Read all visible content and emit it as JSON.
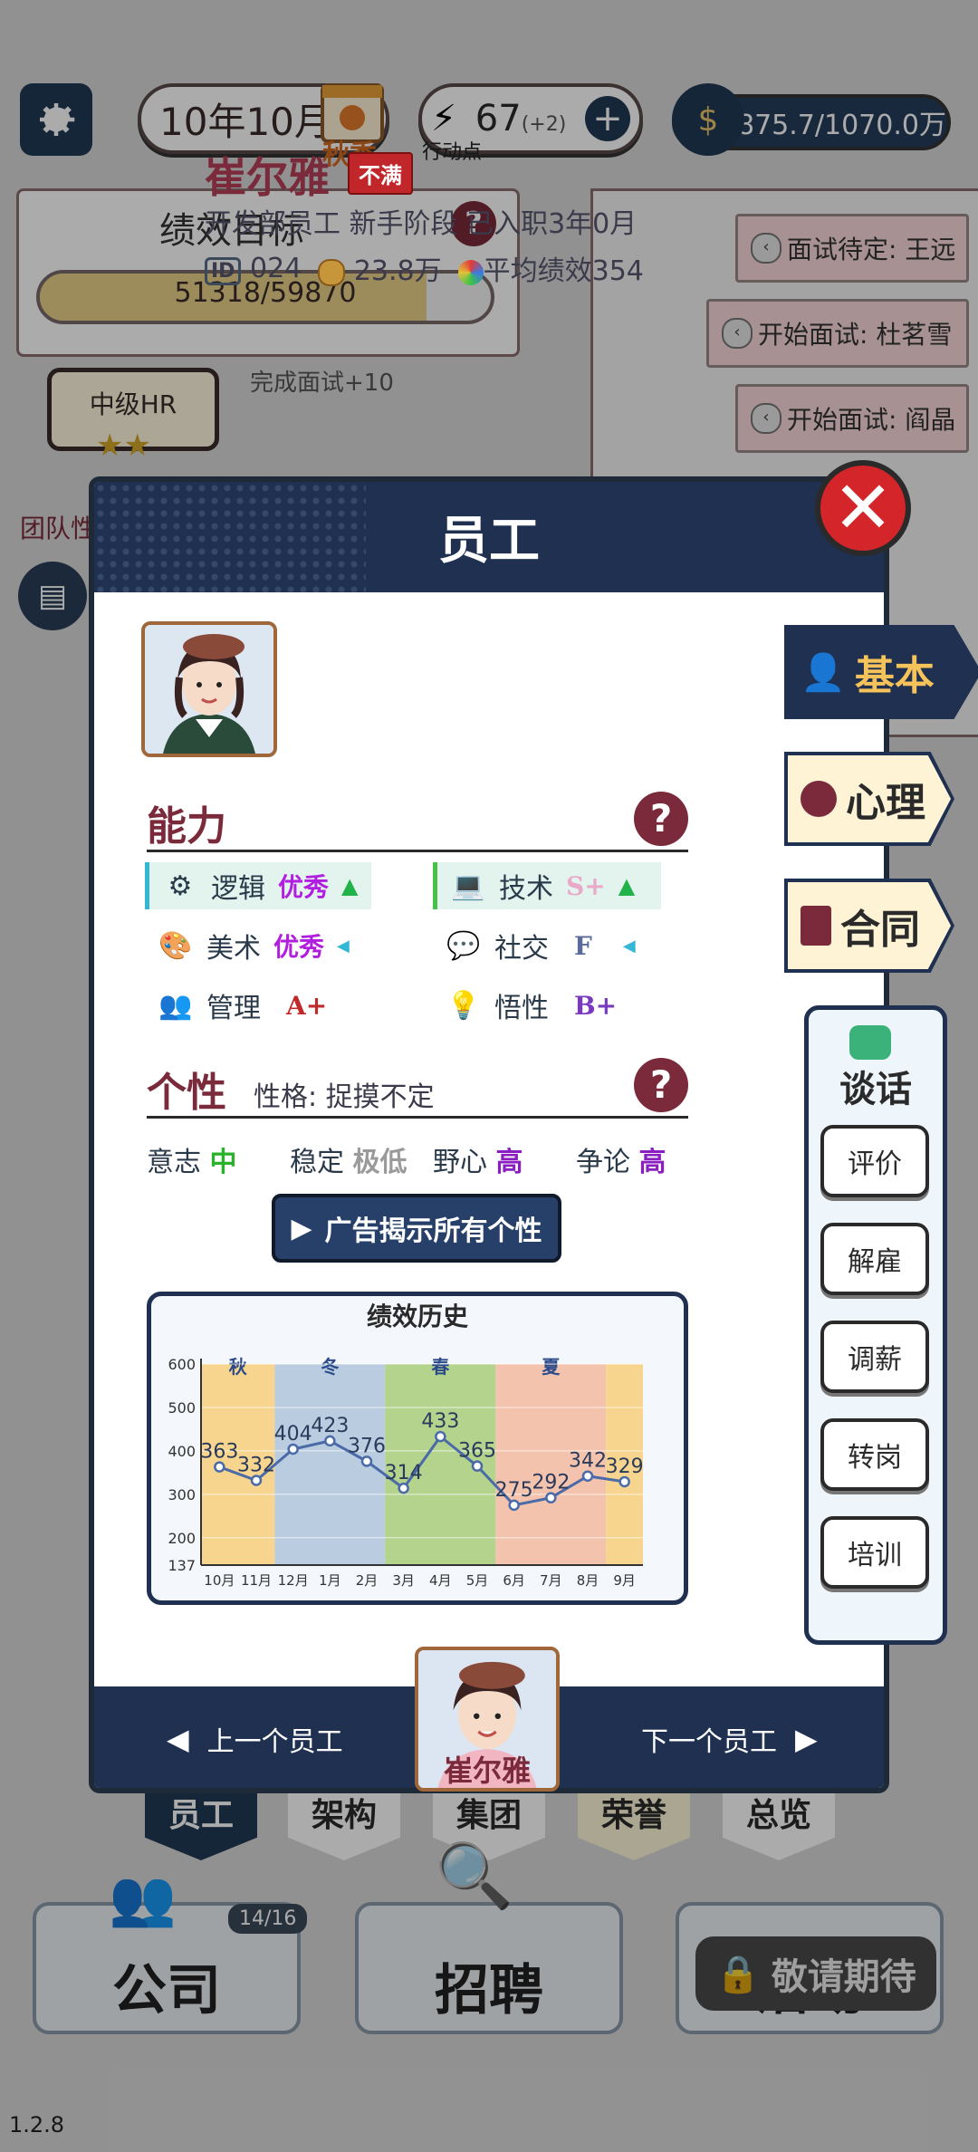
{
  "hud": {
    "date": "10年10月",
    "season": "秋季",
    "action_points": "67",
    "action_points_bonus": "(+2)",
    "action_points_label": "行动点",
    "money": "875.7/1070.0万"
  },
  "kpi": {
    "title": "绩效目标",
    "progress_text": "51318/59870",
    "progress_fraction": 0.857
  },
  "level": {
    "title": "中级HR",
    "stars": "★★",
    "note": "完成面试+10"
  },
  "team_label": "团队性",
  "tasks": [
    {
      "label": "面试待定: 王远"
    },
    {
      "label": "开始面试: 杜茗雪"
    },
    {
      "label": "开始面试: 阎晶"
    }
  ],
  "dialog": {
    "title": "员工",
    "employee": {
      "name": "崔尔雅",
      "mood": "不满",
      "desc": "开发部员工  新手阶段  已入职3年0月",
      "id_label": "ID",
      "id": "024",
      "salary": "23.8万",
      "avg_perf": "平均绩效354"
    },
    "ability": {
      "title": "能力",
      "items": [
        {
          "label": "逻辑",
          "grade": "优秀",
          "grade_color": "#b21ee0",
          "trend": "▲",
          "icon": "brain-gear-icon"
        },
        {
          "label": "技术",
          "grade": "S+",
          "grade_color": "#e9a9c8",
          "trend": "▲",
          "icon": "code-laptop-icon"
        },
        {
          "label": "美术",
          "grade": "优秀",
          "grade_color": "#b21ee0",
          "trend": "◀",
          "icon": "palette-icon"
        },
        {
          "label": "社交",
          "grade": "F",
          "grade_color": "#5a6a9a",
          "trend": "◀",
          "icon": "chat-bubbles-icon"
        },
        {
          "label": "管理",
          "grade": "A+",
          "grade_color": "#c02a2a",
          "trend": "",
          "icon": "manager-icon"
        },
        {
          "label": "悟性",
          "grade": "B+",
          "grade_color": "#7a3ac0",
          "trend": "",
          "icon": "lightbulb-icon"
        }
      ]
    },
    "personality": {
      "title": "个性",
      "subtitle": "性格: 捉摸不定",
      "traits": [
        {
          "label": "意志",
          "value": "中",
          "color": "#2ab22a"
        },
        {
          "label": "稳定",
          "value": "极低",
          "color": "#9a9a9a"
        },
        {
          "label": "野心",
          "value": "高",
          "color": "#8a1ec0"
        },
        {
          "label": "争论",
          "value": "高",
          "color": "#8a1ec0"
        }
      ],
      "ad_button": "广告揭示所有个性"
    },
    "prev_button": "上一个员工",
    "next_button": "下一个员工"
  },
  "side_tabs": [
    {
      "label": "基本",
      "active": true,
      "icon": "person-icon"
    },
    {
      "label": "心理",
      "active": false,
      "icon": "speech-icon"
    },
    {
      "label": "合同",
      "active": false,
      "icon": "document-icon"
    }
  ],
  "talk": {
    "title": "谈话",
    "buttons": [
      "评价",
      "解雇",
      "调薪",
      "转岗",
      "培训"
    ]
  },
  "bottom_nav": {
    "tabs": [
      "员工",
      "架构",
      "集团",
      "荣誉",
      "总览"
    ],
    "company": "公司",
    "company_count": "14/16",
    "recruit": "招聘",
    "activity": "活动",
    "locked": "敬请期待"
  },
  "version": "1.2.8",
  "chart_data": {
    "type": "line",
    "title": "绩效历史",
    "categories": [
      "10月",
      "11月",
      "12月",
      "1月",
      "2月",
      "3月",
      "4月",
      "5月",
      "6月",
      "7月",
      "8月",
      "9月"
    ],
    "values": [
      363,
      332,
      404,
      423,
      376,
      314,
      433,
      365,
      275,
      292,
      342,
      329
    ],
    "ylim": [
      137,
      600
    ],
    "yticks": [
      137,
      200,
      300,
      400,
      500,
      600
    ],
    "season_bands": [
      {
        "label": "秋",
        "from": 0,
        "to": 1,
        "color": "#f7d58e"
      },
      {
        "label": "冬",
        "from": 2,
        "to": 4,
        "color": "#b9cce0"
      },
      {
        "label": "春",
        "from": 5,
        "to": 7,
        "color": "#b4d48e"
      },
      {
        "label": "夏",
        "from": 8,
        "to": 10,
        "color": "#f4c3ad"
      },
      {
        "label": "",
        "from": 11,
        "to": 11,
        "color": "#f7d58e"
      }
    ],
    "line_color": "#4a6aa8"
  }
}
